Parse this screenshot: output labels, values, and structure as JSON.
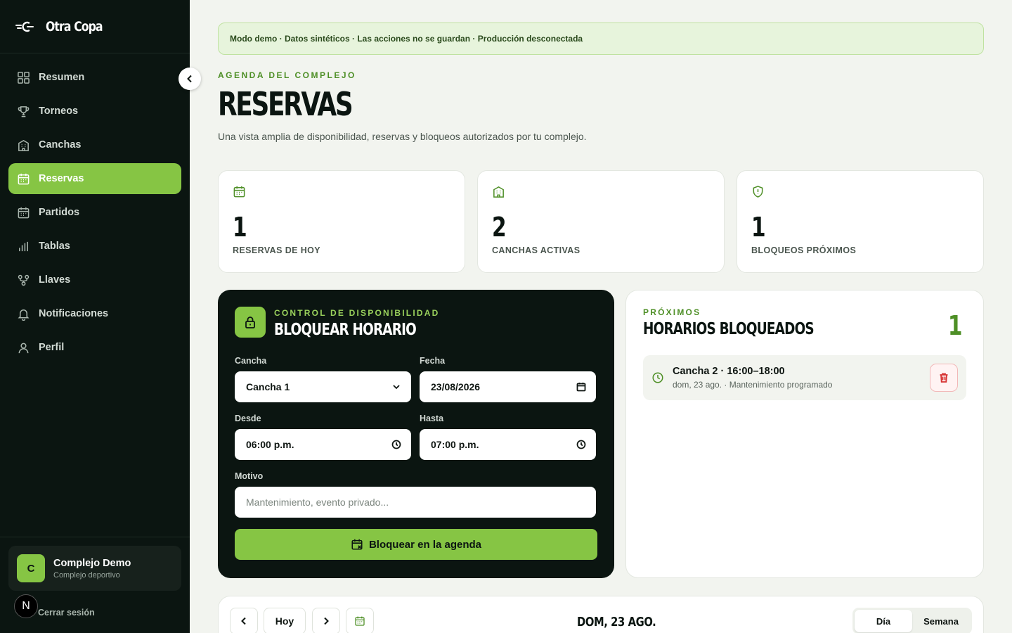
{
  "brand": {
    "name": "Otra Copa"
  },
  "nav": [
    {
      "label": "Resumen",
      "icon": "grid-icon",
      "active": false
    },
    {
      "label": "Torneos",
      "icon": "trophy-icon",
      "active": false
    },
    {
      "label": "Canchas",
      "icon": "building-icon",
      "active": false
    },
    {
      "label": "Reservas",
      "icon": "calendar-icon",
      "active": true
    },
    {
      "label": "Partidos",
      "icon": "calendar-icon",
      "active": false
    },
    {
      "label": "Tablas",
      "icon": "bar-chart-icon",
      "active": false
    },
    {
      "label": "Llaves",
      "icon": "bracket-icon",
      "active": false
    },
    {
      "label": "Notificaciones",
      "icon": "bell-icon",
      "active": false
    },
    {
      "label": "Perfil",
      "icon": "user-icon",
      "active": false
    }
  ],
  "org": {
    "initial": "C",
    "name": "Complejo Demo",
    "type": "Complejo deportivo"
  },
  "logout_label": "Cerrar sesión",
  "n_badge": "N",
  "demo_banner": "Modo demo · Datos sintéticos · Las acciones no se guardan · Producción desconectada",
  "header": {
    "eyebrow": "AGENDA DEL COMPLEJO",
    "title": "RESERVAS",
    "description": "Una vista amplia de disponibilidad, reservas y bloqueos autorizados por tu complejo."
  },
  "stats": [
    {
      "value": "1",
      "label": "RESERVAS DE HOY",
      "icon": "calendar-icon"
    },
    {
      "value": "2",
      "label": "CANCHAS ACTIVAS",
      "icon": "building-icon"
    },
    {
      "value": "1",
      "label": "BLOQUEOS PRÓXIMOS",
      "icon": "shield-icon"
    }
  ],
  "block_form": {
    "eyebrow": "CONTROL DE DISPONIBILIDAD",
    "title": "BLOQUEAR HORARIO",
    "court_label": "Cancha",
    "court_value": "Cancha 1",
    "date_label": "Fecha",
    "date_value": "23/08/2026",
    "from_label": "Desde",
    "from_value": "06:00 p.m.",
    "to_label": "Hasta",
    "to_value": "07:00 p.m.",
    "reason_label": "Motivo",
    "reason_placeholder": "Mantenimiento, evento privado...",
    "submit_label": "Bloquear en la agenda"
  },
  "blocked": {
    "eyebrow": "PRÓXIMOS",
    "title": "HORARIOS BLOQUEADOS",
    "count": "1",
    "items": [
      {
        "title": "Cancha 2 · 16:00–18:00",
        "subtitle": "dom, 23 ago. · Mantenimiento programado"
      }
    ]
  },
  "calendar": {
    "today_label": "Hoy",
    "current_date": "DOM, 23 AGO.",
    "views": [
      {
        "label": "Día",
        "active": true
      },
      {
        "label": "Semana",
        "active": false
      }
    ]
  },
  "colors": {
    "accent": "#86c544",
    "sidebar_bg": "#0b1511",
    "danger": "#d63232"
  }
}
